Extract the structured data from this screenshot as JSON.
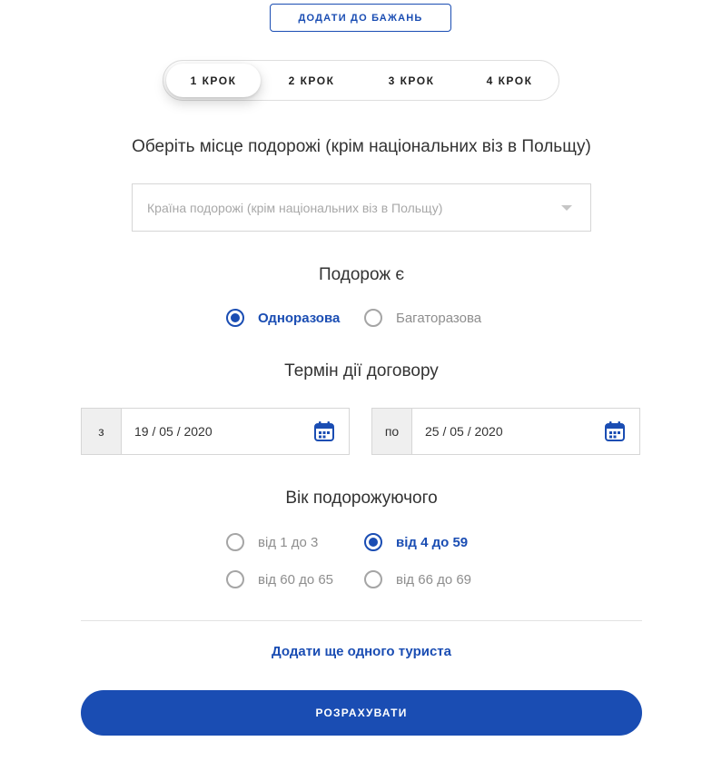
{
  "wishlist_button": "ДОДАТИ ДО БАЖАНЬ",
  "steps": [
    {
      "label": "1 КРОК",
      "active": true
    },
    {
      "label": "2 КРОК",
      "active": false
    },
    {
      "label": "3 КРОК",
      "active": false
    },
    {
      "label": "4 КРОК",
      "active": false
    }
  ],
  "destination": {
    "title": "Оберіть місце подорожі (крім національних віз в Польщу)",
    "placeholder": "Країна подорожі (крім національних віз в Польщу)"
  },
  "trip_type": {
    "title": "Подорож є",
    "options": [
      {
        "label": "Одноразова",
        "checked": true
      },
      {
        "label": "Багаторазова",
        "checked": false
      }
    ]
  },
  "contract_term": {
    "title": "Термін дії договору",
    "from": {
      "prefix": "з",
      "value": "19 / 05 / 2020"
    },
    "to": {
      "prefix": "по",
      "value": "25 / 05 / 2020"
    }
  },
  "traveler_age": {
    "title": "Вік подорожуючого",
    "options": [
      {
        "label": "від 1 до 3",
        "checked": false
      },
      {
        "label": "від 4 до 59",
        "checked": true
      },
      {
        "label": "від 60 до 65",
        "checked": false
      },
      {
        "label": "від 66 до 69",
        "checked": false
      }
    ]
  },
  "add_tourist_link": "Додати ще одного туриста",
  "calculate_button": "РОЗРАХУВАТИ",
  "colors": {
    "accent": "#1a4db3",
    "muted_text": "#8e8e8e",
    "border": "#d6d6d6"
  },
  "icons": {
    "date_picker": "calendar-icon",
    "select": "chevron-down-icon"
  }
}
